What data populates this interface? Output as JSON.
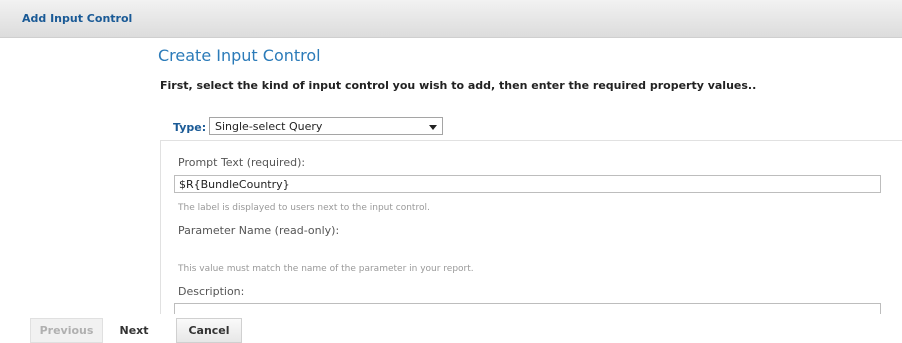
{
  "window": {
    "title": "Add Input Control"
  },
  "main": {
    "heading": "Create Input Control",
    "instruction": "First, select the kind of input control you wish to add, then enter the required property values.."
  },
  "type_field": {
    "label": "Type:",
    "selected": "Single-select Query"
  },
  "form": {
    "prompt_label": "Prompt Text (required):",
    "prompt_value": "$R{BundleCountry}",
    "prompt_hint": "The label is displayed to users next to the input control.",
    "param_label": "Parameter Name (read-only):",
    "param_hint": "This value must match the name of the parameter in your report.",
    "description_label": "Description:",
    "description_value": ""
  },
  "footer": {
    "previous_label": "Previous",
    "next_label": "Next",
    "cancel_label": "Cancel"
  }
}
